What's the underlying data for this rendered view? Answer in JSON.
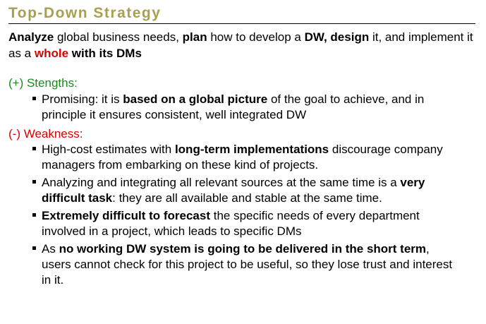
{
  "slide": {
    "title": "Top-Down Strategy",
    "intro": {
      "t1": "Analyze",
      "t2": " global business needs, ",
      "t3": "plan",
      "t4": " how to develop a ",
      "t5": "DW, design",
      "t6": " it, and implement it as a ",
      "t7": "whole",
      "t8": " with its DMs"
    },
    "strengths": {
      "heading": "(+) Stengths:",
      "items": [
        {
          "a": "Promising: it is ",
          "b": "based on a global picture",
          "c": " of the goal to achieve, and in principle it ensures consistent, well integrated DW"
        }
      ]
    },
    "weakness": {
      "heading": "(-) Weakness:",
      "items": [
        {
          "a": "High-cost estimates with ",
          "b": "long-term implementations",
          "c": " discourage company managers from embarking on these kind of projects."
        },
        {
          "a": "Analyzing and integrating all relevant sources at the same time is a ",
          "b": "very difficult task",
          "c": ": they are all available and stable at the same time."
        },
        {
          "a": "",
          "b": "Extremely difficult to forecast",
          "c": " the specific needs of every department involved in a project, which leads to specific DMs"
        },
        {
          "a": "As ",
          "b": "no working DW system is going to be delivered in the short term",
          "c": ", users cannot check for this project to be useful, so they lose trust and interest in it."
        }
      ]
    },
    "colors": {
      "title": "#a8a050",
      "strengths_heading": "#1a8a1a",
      "weakness_heading": "#dd0000",
      "emphasis_red": "#dd0000"
    },
    "icons": {
      "bullet": "square-bullet-icon"
    }
  }
}
